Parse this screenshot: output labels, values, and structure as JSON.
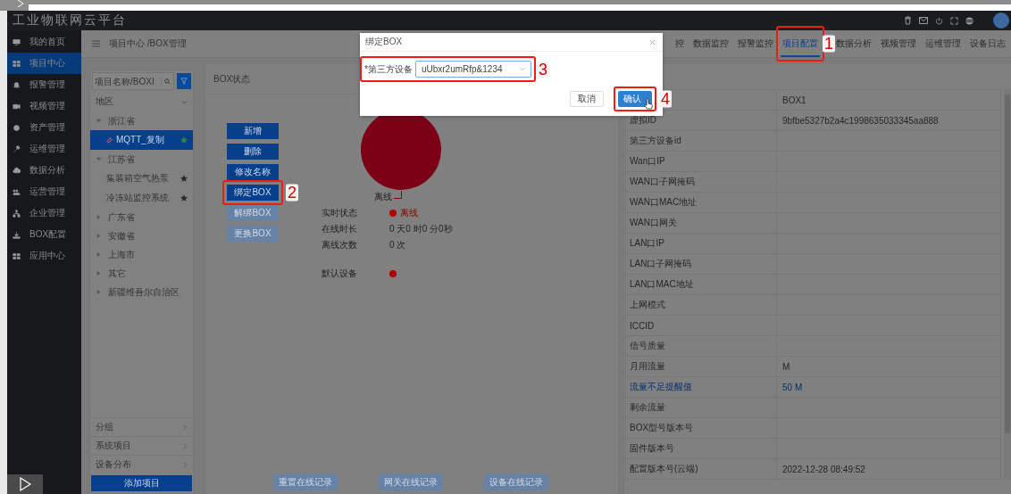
{
  "app_title": "工业物联网云平台",
  "sidebar": [
    {
      "label": "我的首页",
      "selected": false
    },
    {
      "label": "项目中心",
      "selected": true
    },
    {
      "label": "报警管理",
      "selected": false
    },
    {
      "label": "视频管理",
      "selected": false
    },
    {
      "label": "资产管理",
      "selected": false
    },
    {
      "label": "运维管理",
      "selected": false
    },
    {
      "label": "数据分析",
      "selected": false
    },
    {
      "label": "运营管理",
      "selected": false
    },
    {
      "label": "企业管理",
      "selected": false
    },
    {
      "label": "BOX配置",
      "selected": false
    },
    {
      "label": "应用中心",
      "selected": false
    }
  ],
  "breadcrumb": "项目中心 /BOX管理",
  "tabs": [
    {
      "label": "控",
      "selected": false
    },
    {
      "label": "数据监控",
      "selected": false
    },
    {
      "label": "报警监控",
      "selected": false
    },
    {
      "label": "项目配置",
      "selected": true,
      "annotation": "1"
    },
    {
      "label": "数据分析",
      "selected": false
    },
    {
      "label": "视频管理",
      "selected": false
    },
    {
      "label": "运维管理",
      "selected": false
    },
    {
      "label": "设备日志",
      "selected": false
    }
  ],
  "tree_panel": {
    "search": {
      "placeholder": "项目名称/BOXI"
    },
    "region": "地区",
    "tree": [
      {
        "label": "浙江省",
        "expanded": true,
        "children": [
          {
            "label": "MQTT_复制",
            "selected": true,
            "flagged": true
          }
        ]
      },
      {
        "label": "江苏省",
        "expanded": true,
        "children": [
          {
            "label": "集装箱空气热泵",
            "selected": false,
            "flagged": false
          },
          {
            "label": "冷冻站监控系统",
            "selected": false,
            "flagged": false
          }
        ]
      },
      {
        "label": "广东省",
        "expanded": false
      },
      {
        "label": "安徽省",
        "expanded": false
      },
      {
        "label": "上海市",
        "expanded": false
      },
      {
        "label": "其它",
        "expanded": false
      },
      {
        "label": "新疆维吾尔自治区",
        "expanded": false
      }
    ],
    "links": [
      "分组",
      "系统项目",
      "设备分布"
    ],
    "add_button": "添加项目"
  },
  "box_panel": {
    "title": "BOX状态",
    "actions": [
      {
        "label": "新增",
        "disabled": false
      },
      {
        "label": "删除",
        "disabled": false
      },
      {
        "label": "修改名称",
        "disabled": false
      },
      {
        "label": "绑定BOX",
        "disabled": false,
        "annotation": "2"
      },
      {
        "label": "解绑BOX",
        "disabled": true
      },
      {
        "label": "更换BOX",
        "disabled": true
      }
    ],
    "pie_label": "离线",
    "status": [
      {
        "label": "实时状态",
        "value": "离线",
        "indicator": true
      },
      {
        "label": "在线时长",
        "value": "0 天0 时0 分0秒",
        "indicator": false
      },
      {
        "label": "离线次数",
        "value": "0 次",
        "indicator": false
      },
      {
        "label": "默认设备",
        "indicator": true
      }
    ],
    "records": [
      {
        "label": "重置在线记录",
        "disabled": true
      },
      {
        "label": "网关在线记录",
        "disabled": true
      },
      {
        "label": "设备在线记录",
        "disabled": true
      }
    ]
  },
  "info_table": [
    {
      "value": "BOX1",
      "link": false
    },
    {
      "label": "虚拟ID",
      "value": "9bfbe5327b2a4c1998635033345aa888",
      "link": false
    },
    {
      "label": "第三方设备id",
      "link": false
    },
    {
      "label": "Wan口IP",
      "link": false
    },
    {
      "label": "WAN口子网掩码",
      "link": false
    },
    {
      "label": "WAN口MAC地址",
      "link": false
    },
    {
      "label": "WAN口网关",
      "link": false
    },
    {
      "label": "LAN口IP",
      "link": false
    },
    {
      "label": "LAN口子网掩码",
      "link": false
    },
    {
      "label": "LAN口MAC地址",
      "link": false
    },
    {
      "label": "上网模式",
      "link": false
    },
    {
      "label": "ICCID",
      "link": false
    },
    {
      "label": "信号质量",
      "link": false
    },
    {
      "label": "月用流量",
      "value": "M",
      "link": false
    },
    {
      "label": "流量不足提醒值",
      "value": "50  M",
      "link": true
    },
    {
      "label": "剩余流量",
      "link": false
    },
    {
      "label": "BOX型号版本号",
      "link": false
    },
    {
      "label": "固件版本号",
      "link": false
    },
    {
      "label": "配置版本号(云端)",
      "value": "2022-12-28 08:49:52",
      "link": false
    }
  ],
  "dialog": {
    "title": "绑定BOX",
    "field": {
      "label": "*第三方设备",
      "value": "uUbxr2umRfp&1234",
      "annotation": "3"
    },
    "buttons": [
      {
        "label": "取消",
        "kind": "default"
      },
      {
        "label": "确认",
        "kind": "primary",
        "annotation": "4"
      }
    ]
  }
}
